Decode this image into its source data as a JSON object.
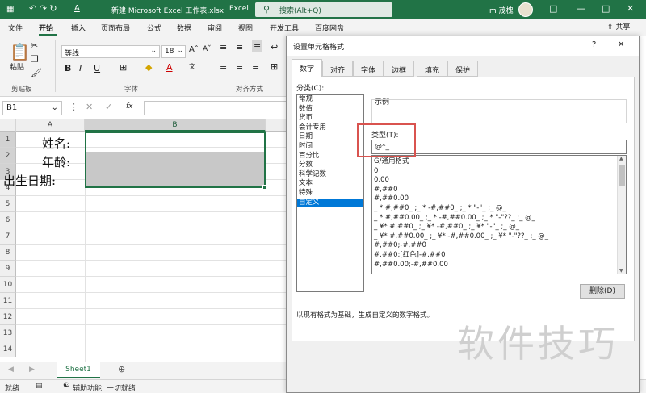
{
  "titlebar": {
    "autosave_icons": "↶ ↷ ↻",
    "font_color_icon": "A",
    "filename": "新建 Microsoft Excel 工作表.xlsx",
    "app": "Excel",
    "search_placeholder": "搜索(Alt+Q)",
    "user": "m 茂槐",
    "accent": "#217346"
  },
  "tabs": [
    "文件",
    "开始",
    "插入",
    "页面布局",
    "公式",
    "数据",
    "审阅",
    "视图",
    "开发工具",
    "百度网盘"
  ],
  "active_tab": "开始",
  "share_label": "共享",
  "ribbon": {
    "paste": "粘贴",
    "clipboard_group": "剪贴板",
    "font_name": "等线",
    "font_size": "18",
    "font_group": "字体",
    "align_group": "对齐方式",
    "bold": "B",
    "italic": "I",
    "underline": "U",
    "grow_font": "Aˆ",
    "shrink_font": "Aˇ"
  },
  "formula_bar": {
    "name_box": "B1",
    "fx": "fx"
  },
  "grid": {
    "columns": [
      "A",
      "B"
    ],
    "rows": [
      "1",
      "2",
      "3",
      "4",
      "5",
      "6",
      "7",
      "8",
      "9",
      "10",
      "11",
      "12",
      "13",
      "14"
    ],
    "labels": [
      "姓名:",
      "年龄:",
      "出生日期:"
    ]
  },
  "sheet_tab": "Sheet1",
  "status": {
    "ready": "就绪",
    "accessibility": "辅助功能: 一切就绪"
  },
  "dialog": {
    "title": "设置单元格格式",
    "help": "?",
    "close": "✕",
    "tabs": [
      "数字",
      "对齐",
      "字体",
      "边框",
      "填充",
      "保护"
    ],
    "active_tab": "数字",
    "category_label": "分类(C):",
    "categories": [
      "常规",
      "数值",
      "货币",
      "会计专用",
      "日期",
      "时间",
      "百分比",
      "分数",
      "科学记数",
      "文本",
      "特殊",
      "自定义"
    ],
    "selected_category": "自定义",
    "sample_label": "示例",
    "type_label": "类型(T):",
    "type_value": "@*_",
    "formats": [
      "G/通用格式",
      "0",
      "0.00",
      "#,##0",
      "#,##0.00",
      "_ * #,##0_ ;_ * -#,##0_ ;_ * \"-\"_ ;_ @_",
      "_ * #,##0.00_ ;_ * -#,##0.00_ ;_ * \"-\"??_ ;_ @_",
      "_ ¥* #,##0_ ;_ ¥* -#,##0_ ;_ ¥* \"-\"_ ;_ @_",
      "_ ¥* #,##0.00_ ;_ ¥* -#,##0.00_ ;_ ¥* \"-\"??_ ;_ @_",
      "#,##0;-#,##0",
      "#,##0;[红色]-#,##0",
      "#,##0.00;-#,##0.00"
    ],
    "delete_button": "删除(D)",
    "description": "以现有格式为基础，生成自定义的数字格式。"
  },
  "watermark": "软件技巧"
}
